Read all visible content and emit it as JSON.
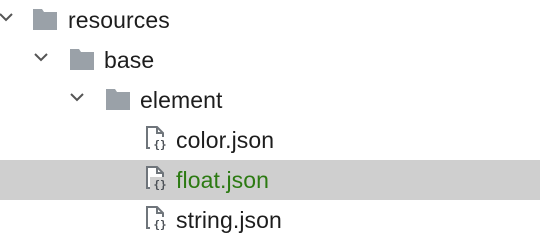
{
  "project_tree": {
    "items": [
      {
        "label": "resources",
        "icon": "folder-icon",
        "expanded": true
      },
      {
        "label": "base",
        "icon": "folder-icon",
        "expanded": true
      },
      {
        "label": "element",
        "icon": "folder-icon",
        "expanded": true
      },
      {
        "label": "color.json",
        "icon": "json-file-icon"
      },
      {
        "label": "float.json",
        "icon": "json-file-icon",
        "selected": true
      },
      {
        "label": "string.json",
        "icon": "json-file-icon"
      }
    ]
  },
  "colors": {
    "folder": "#9aa1a8",
    "file_icon": "#6f757b",
    "chevron": "#555555",
    "selection_background": "#cfcfcf",
    "selected_text": "#2c7a12",
    "text": "#1d1d1d"
  }
}
